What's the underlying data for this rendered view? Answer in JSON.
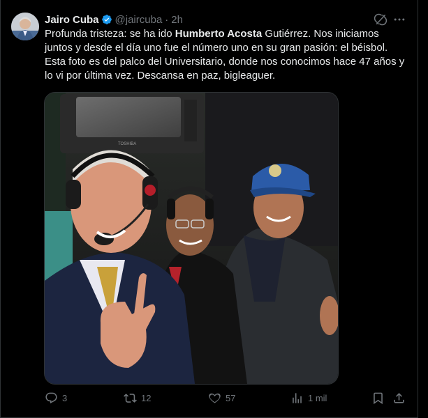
{
  "tweet": {
    "author": {
      "name": "Jairo Cuba",
      "handle": "@jaircuba",
      "time": "2h",
      "separator": "·"
    },
    "text": {
      "part1": "Profunda tristeza: se ha ido ",
      "bold": "Humberto Acosta",
      "part2": " Gutiérrez. Nos iniciamos juntos y desde el día uno fue el número uno en su gran pasión: el béisbol. Esta foto es del palco del Universitario, donde nos conocimos hace 47 años y lo vi por última vez. Descansa en paz, bigleaguer."
    },
    "media": {
      "tv_brand": "TOSHIBA"
    },
    "stats": {
      "replies": "3",
      "reposts": "12",
      "likes": "57",
      "views": "1 mil"
    }
  },
  "colors": {
    "background": "#000000",
    "text": "#e7e9ea",
    "muted": "#71767b",
    "verified": "#1d9bf0",
    "border": "#2f3336"
  },
  "icons": [
    "verified-badge-icon",
    "grok-icon",
    "more-icon",
    "reply-icon",
    "repost-icon",
    "like-icon",
    "views-icon",
    "bookmark-icon",
    "share-icon"
  ]
}
